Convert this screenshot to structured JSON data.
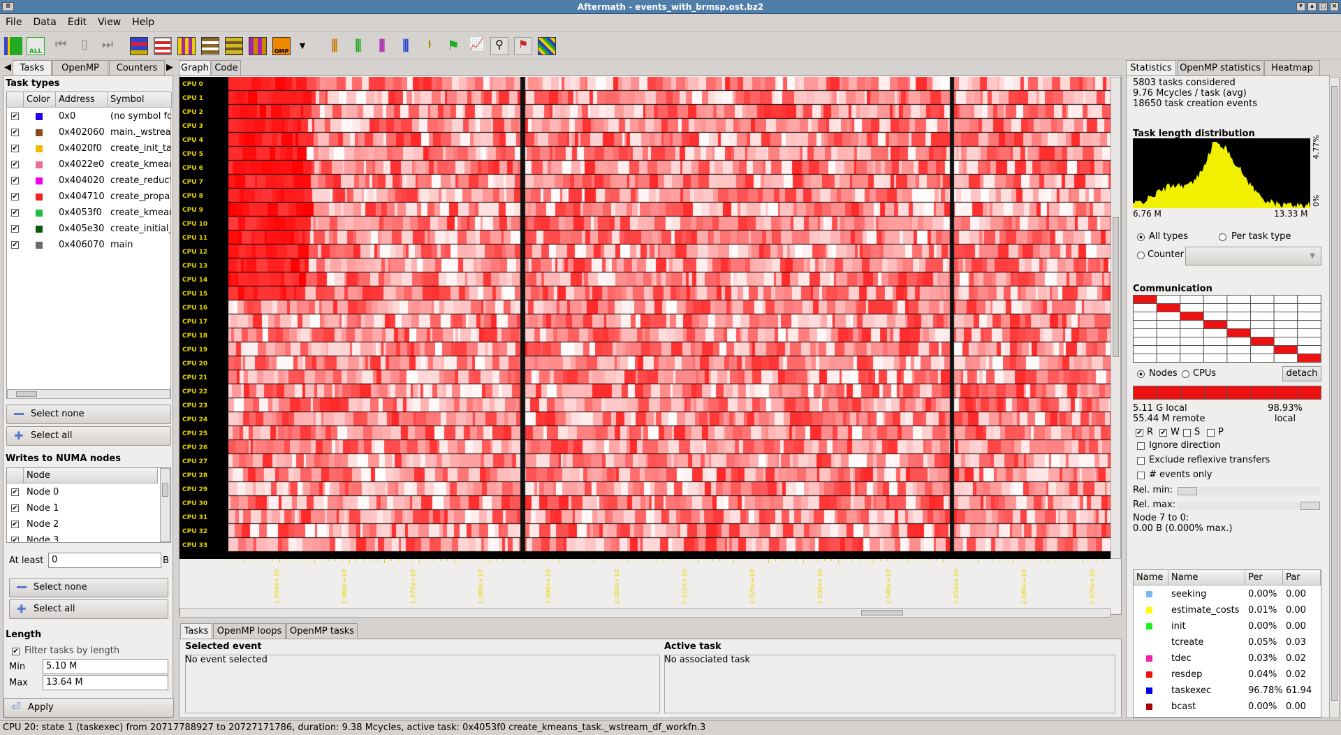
{
  "window": {
    "title": "Aftermath - events_with_brmsp.ost.bz2"
  },
  "menu": [
    "File",
    "Data",
    "Edit",
    "View",
    "Help"
  ],
  "toolbar_icons": [
    "select-all-types-icon",
    "select-all-icon",
    "go-start-icon",
    "pause-icon",
    "go-end-icon",
    "heatmap-mode-icon",
    "state-mode-icon",
    "task-type-mode-icon",
    "numa-read-mode-icon",
    "numa-write-mode-icon",
    "heatmap-numa-icon",
    "openmp-mode-icon",
    "dropdown-icon",
    "steals-icon",
    "pushes-icon",
    "data-reads-icon",
    "data-writes-icon",
    "task-lines-icon",
    "flag-icon",
    "chart-icon",
    "annotation-icon",
    "flag-pair-icon",
    "numa-map-icon"
  ],
  "left": {
    "tabs": [
      "Tasks",
      "OpenMP",
      "Counters"
    ],
    "task_types": {
      "title": "Task types",
      "columns": [
        "Color",
        "Address",
        "Symbol"
      ],
      "rows": [
        {
          "color": "#2200ee",
          "address": "0x0",
          "symbol": "(no symbol fo"
        },
        {
          "color": "#8b4a1a",
          "address": "0x402060",
          "symbol": "main._wstrea"
        },
        {
          "color": "#f0b800",
          "address": "0x4020f0",
          "symbol": "create_init_ta"
        },
        {
          "color": "#ee6a9a",
          "address": "0x4022e0",
          "symbol": "create_kmear"
        },
        {
          "color": "#ee00ee",
          "address": "0x404020",
          "symbol": "create_reduct"
        },
        {
          "color": "#ee2222",
          "address": "0x404710",
          "symbol": "create_propag"
        },
        {
          "color": "#22bb44",
          "address": "0x4053f0",
          "symbol": "create_kmear"
        },
        {
          "color": "#0a5a0a",
          "address": "0x405e30",
          "symbol": "create_initial_"
        },
        {
          "color": "#6a6a72",
          "address": "0x406070",
          "symbol": "main"
        }
      ],
      "select_none": "Select none",
      "select_all": "Select all"
    },
    "numa": {
      "title": "Writes to NUMA nodes",
      "column": "Node",
      "nodes": [
        "Node 0",
        "Node 1",
        "Node 2",
        "Node 3"
      ],
      "at_least_label": "At least",
      "at_least_value": "0",
      "unit": "B",
      "select_none": "Select none",
      "select_all": "Select all"
    },
    "length": {
      "title": "Length",
      "filter_label": "Filter tasks by length",
      "min_label": "Min",
      "min_value": "5.10 M",
      "max_label": "Max",
      "max_value": "13.64 M",
      "apply": "Apply"
    }
  },
  "center": {
    "tabs": [
      "Graph",
      "Code"
    ],
    "cpus": [
      "CPU 0",
      "CPU 1",
      "CPU 2",
      "CPU 3",
      "CPU 4",
      "CPU 5",
      "CPU 6",
      "CPU 7",
      "CPU 8",
      "CPU 9",
      "CPU 10",
      "CPU 11",
      "CPU 12",
      "CPU 13",
      "CPU 14",
      "CPU 15",
      "CPU 16",
      "CPU 17",
      "CPU 18",
      "CPU 19",
      "CPU 20",
      "CPU 21",
      "CPU 22",
      "CPU 23",
      "CPU 24",
      "CPU 25",
      "CPU 26",
      "CPU 27",
      "CPU 28",
      "CPU 29",
      "CPU 30",
      "CPU 31",
      "CPU 32",
      "CPU 33"
    ],
    "axis_labels": [
      "1.950e+10",
      "1.960e+10",
      "1.970e+10",
      "1.980e+10",
      "1.990e+10",
      "2.000e+10",
      "2.010e+10",
      "2.020e+10",
      "2.030e+10",
      "2.040e+10",
      "2.050e+10",
      "2.060e+10",
      "2.070e+10"
    ],
    "bottom_tabs": [
      "Tasks",
      "OpenMP loops",
      "OpenMP tasks"
    ],
    "selected_event": {
      "title": "Selected event",
      "text": "No event selected"
    },
    "active_task": {
      "title": "Active task",
      "text": "No associated task"
    }
  },
  "right": {
    "tabs": [
      "Statistics",
      "OpenMP statistics",
      "Heatmap"
    ],
    "summary": [
      "5803 tasks considered",
      "9.76 Mcycles / task (avg)",
      "18650 task creation events"
    ],
    "histogram": {
      "title": "Task length distribution",
      "x_min": "6.76 M",
      "x_max": "13.33 M",
      "y_max": "4.77%",
      "y_min": "0%"
    },
    "types_options": {
      "all": "All types",
      "per": "Per task type",
      "counter": "Counter"
    },
    "communication": {
      "title": "Communication",
      "nodes": "Nodes",
      "cpus": "CPUs",
      "detach": "detach",
      "local": "5.11 G local",
      "remote": "55.44 M remote",
      "pct": "98.93%",
      "pct_label": "local",
      "flags": [
        "R",
        "W",
        "S",
        "P"
      ],
      "ignore_direction": "Ignore direction",
      "exclude_reflexive": "Exclude reflexive transfers",
      "events_only": "# events only",
      "rel_min": "Rel. min:",
      "rel_max": "Rel. max:",
      "node_info": "Node 7 to 0:",
      "node_value": "0.00 B (0.000% max.)"
    },
    "states_table": {
      "columns": [
        "Name",
        "Name",
        "Per",
        "Par"
      ],
      "rows": [
        {
          "color": "#77bbee",
          "name": "seeking",
          "per": "0.00%",
          "par": "0.00"
        },
        {
          "color": "#ffff00",
          "name": "estimate_costs",
          "per": "0.01%",
          "par": "0.00"
        },
        {
          "color": "#22ee22",
          "name": "init",
          "per": "0.00%",
          "par": "0.00"
        },
        {
          "color": "#ffffff",
          "name": "tcreate",
          "per": "0.05%",
          "par": "0.03"
        },
        {
          "color": "#ee22aa",
          "name": "tdec",
          "per": "0.03%",
          "par": "0.02"
        },
        {
          "color": "#ee1111",
          "name": "resdep",
          "per": "0.04%",
          "par": "0.02"
        },
        {
          "color": "#0000ee",
          "name": "taskexec",
          "per": "96.78%",
          "par": "61.94"
        },
        {
          "color": "#aa0000",
          "name": "bcast",
          "per": "0.00%",
          "par": "0.00"
        }
      ]
    }
  },
  "status_bar": "CPU 20: state 1 (taskexec) from 20717788927 to 20727171786, duration: 9.38 Mcycles, active task: 0x4053f0 create_kmeans_task._wstream_df_workfn.3"
}
